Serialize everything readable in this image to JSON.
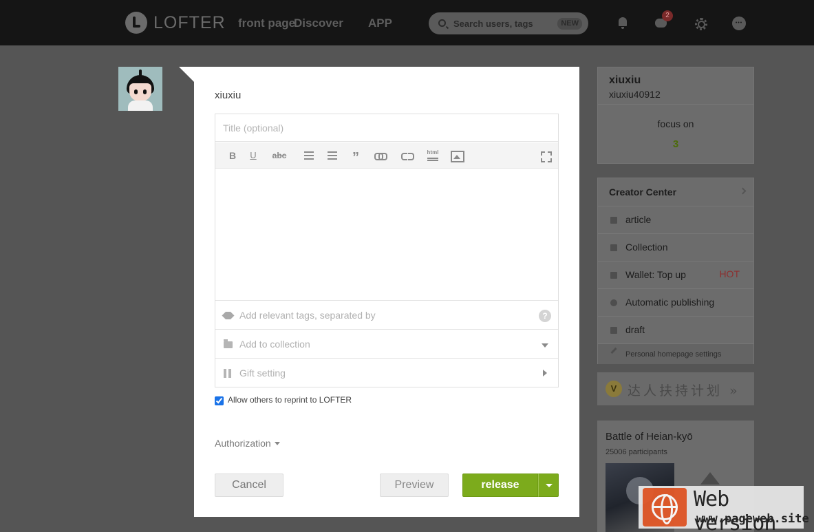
{
  "topbar": {
    "logo_text": "LOFTER",
    "nav": [
      "front page",
      "Discover",
      "APP"
    ],
    "search_placeholder": "Search users, tags",
    "search_badge": "NEW",
    "message_count": "2"
  },
  "editor": {
    "username": "xiuxiu",
    "title_placeholder": "Title (optional)",
    "toolbar": {
      "bold": "B",
      "underline": "U",
      "strike": "abc",
      "quote": "”",
      "html": "html"
    },
    "tags_placeholder": "Add relevant tags, separated by",
    "help": "?",
    "collection_label": "Add to collection",
    "gift_label": "Gift setting",
    "reprint_label": "Allow others to reprint to LOFTER",
    "reprint_checked": true,
    "authorization_label": "Authorization",
    "cancel_label": "Cancel",
    "preview_label": "Preview",
    "release_label": "release"
  },
  "profile": {
    "name": "xiuxiu",
    "id": "xiuxiu40912",
    "focus_label": "focus on",
    "focus_count": "3"
  },
  "creator": {
    "title": "Creator Center",
    "items": [
      {
        "label": "article",
        "icon": "list-icon"
      },
      {
        "label": "Collection",
        "icon": "folder-icon"
      },
      {
        "label": "Wallet: Top up",
        "icon": "wallet-icon",
        "badge": "HOT"
      },
      {
        "label": "Automatic publishing",
        "icon": "clock-icon"
      },
      {
        "label": "draft",
        "icon": "draft-icon"
      }
    ],
    "settings_label": "Personal homepage settings"
  },
  "banner": {
    "badge": "V",
    "text": "达人扶持计划 »"
  },
  "activity": {
    "title": "Battle of Heian-kyō",
    "participants": "25006 participants"
  },
  "watermark": {
    "title": "Web version",
    "url": "www.pageweb.site"
  },
  "colors": {
    "accent_green": "#7cab1c",
    "topbar_bg": "#151515",
    "overlay_bg": "#555555",
    "hot_red": "#8c3030"
  }
}
